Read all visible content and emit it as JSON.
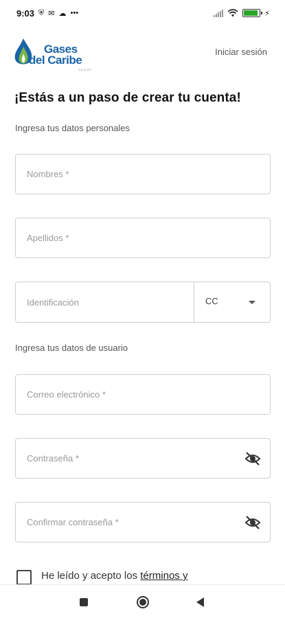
{
  "status_bar": {
    "time": "9:03",
    "icons_left": [
      "shield-icon",
      "mail-icon",
      "cloud-icon",
      "more-icon"
    ],
    "icons_right": [
      "signal-icon",
      "wifi-icon",
      "battery-icon",
      "charging-icon"
    ],
    "battery_level": 0.9
  },
  "header": {
    "brand_line1": "Gases",
    "brand_line2": "del Caribe",
    "brand_sub": "S.A. E.S.P.",
    "login_link": "Iniciar sesión"
  },
  "form": {
    "title": "¡Estás a un paso de crear tu cuenta!",
    "personal_section_label": "Ingresa tus datos personales",
    "first_name_placeholder": "Nombres *",
    "last_name_placeholder": "Apellidos *",
    "id_placeholder": "Identificación",
    "doc_type_value": "CC",
    "user_section_label": "Ingresa tus datos de usuario",
    "email_placeholder": "Correo electrónico *",
    "password_placeholder": "Contraseña *",
    "confirm_password_placeholder": "Confirmar contraseña *"
  },
  "terms": {
    "text": "He leído y acepto los ",
    "link": "términos y"
  },
  "colors": {
    "brand_blue": "#1a64a8",
    "brand_green": "#7ab648",
    "border": "#cfcfcf"
  }
}
